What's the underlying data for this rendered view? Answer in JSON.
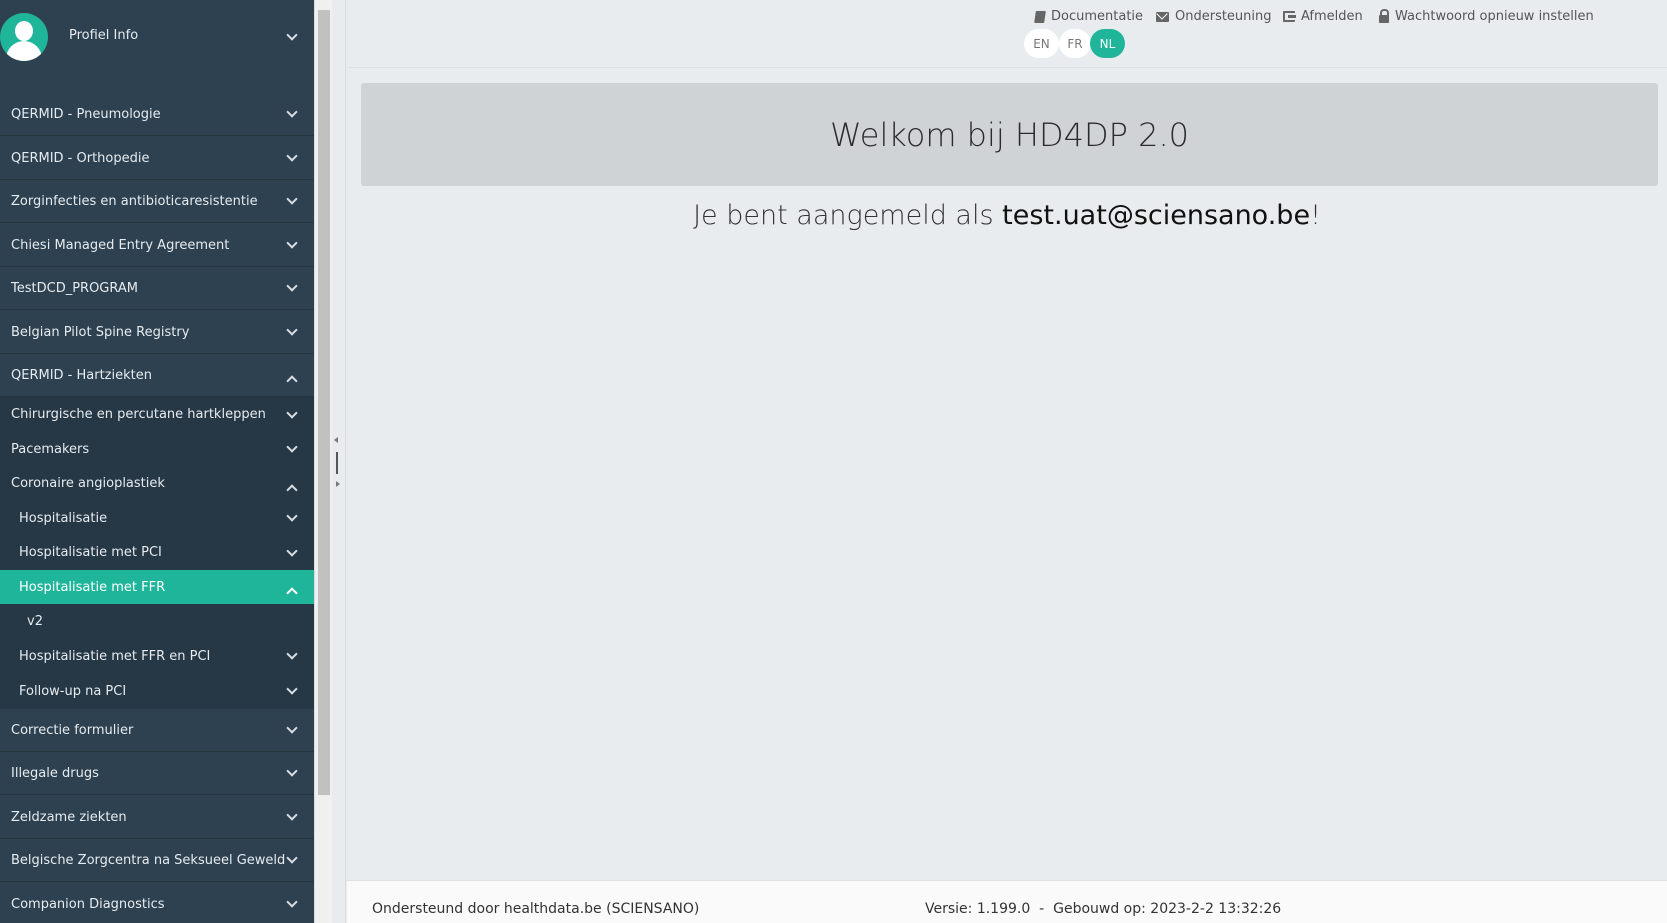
{
  "sidebar": {
    "profile_label": "Profiel Info",
    "items": [
      {
        "label": "QERMID - Pneumologie"
      },
      {
        "label": "QERMID - Orthopedie"
      },
      {
        "label": "Zorginfecties en antibioticaresistentie"
      },
      {
        "label": "Chiesi Managed Entry Agreement"
      },
      {
        "label": "TestDCD_PROGRAM"
      },
      {
        "label": "Belgian Pilot Spine Registry"
      },
      {
        "label": "QERMID - Hartziekten"
      },
      {
        "label": "Chirurgische en percutane hartkleppen"
      },
      {
        "label": "Pacemakers"
      },
      {
        "label": "Coronaire angioplastiek"
      },
      {
        "label": "Hospitalisatie"
      },
      {
        "label": "Hospitalisatie met PCI"
      },
      {
        "label": "Hospitalisatie met FFR"
      },
      {
        "label": "v2"
      },
      {
        "label": "Hospitalisatie met FFR en PCI"
      },
      {
        "label": "Follow-up na PCI"
      },
      {
        "label": "Correctie formulier"
      },
      {
        "label": "Illegale drugs"
      },
      {
        "label": "Zeldzame ziekten"
      },
      {
        "label": "Belgische Zorgcentra na Seksueel Geweld"
      },
      {
        "label": "Companion Diagnostics"
      }
    ]
  },
  "header": {
    "links": {
      "documentation": "Documentatie",
      "support": "Ondersteuning",
      "logout": "Afmelden",
      "reset_password": "Wachtwoord opnieuw instellen"
    },
    "languages": [
      "EN",
      "FR",
      "NL"
    ],
    "active_language": "NL"
  },
  "main": {
    "welcome_title": "Welkom bij HD4DP 2.0",
    "logged_in_prefix": "Je bent aangemeld als ",
    "logged_in_email": "test.uat@sciensano.be",
    "logged_in_suffix": "!"
  },
  "footer": {
    "supported_by": "Ondersteund door healthdata.be (SCIENSANO)",
    "version": "Versie: 1.199.0  -  Gebouwd op: 2023-2-2 13:32:26"
  },
  "colors": {
    "sidebar_bg": "#2e4150",
    "accent": "#1fb59a",
    "main_bg": "#e9ecee"
  }
}
